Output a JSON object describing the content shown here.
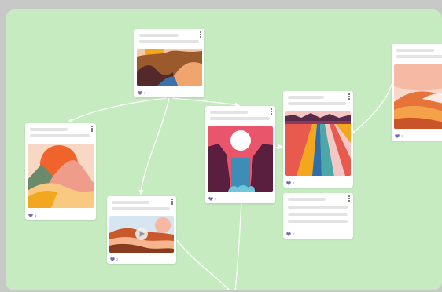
{
  "colors": {
    "canvas_background": "#c7ebc0",
    "frame_background": "#c8c8c8",
    "card_background": "#ffffff",
    "connector": "#ffffff",
    "placeholder_text_line": "#e3e3e3",
    "heart_icon": "#7a6bb0"
  },
  "cards": [
    {
      "id": "card-top",
      "image": "orange-hills-with-sun",
      "likes": "3",
      "has_image": true
    },
    {
      "id": "card-left",
      "image": "desert-dunes-with-sun",
      "likes": "3",
      "has_image": true
    },
    {
      "id": "card-video",
      "image": "mountain-lake-sunset",
      "likes": "2",
      "has_image": true,
      "has_play_button": true
    },
    {
      "id": "card-waterfall",
      "image": "waterfall-at-night-with-moon",
      "likes": "2",
      "has_image": true
    },
    {
      "id": "card-road",
      "image": "colorful-road-to-horizon",
      "likes": "2",
      "has_image": true
    },
    {
      "id": "card-text",
      "image": "",
      "likes": "2",
      "has_image": false
    },
    {
      "id": "card-right-partial",
      "image": "orange-dunes",
      "likes": "2",
      "has_image": true
    }
  ],
  "icons": {
    "menu": "kebab-menu-icon",
    "likes": "heart-icon",
    "video": "play-icon"
  }
}
